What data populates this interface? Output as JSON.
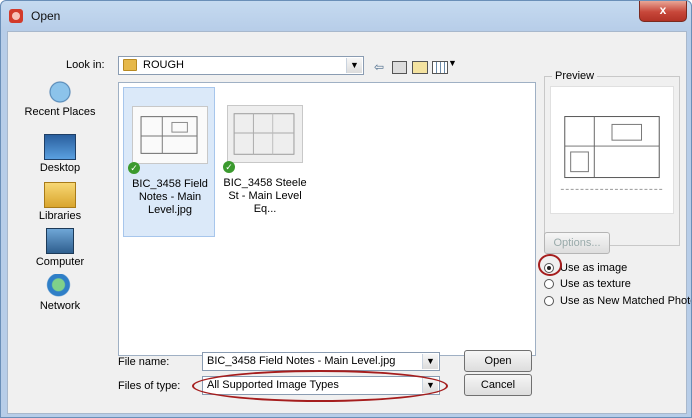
{
  "window": {
    "title": "Open",
    "close_label": "x"
  },
  "look_in": {
    "label": "Look in:",
    "value": "ROUGH"
  },
  "places": [
    {
      "label": "Recent Places",
      "icon": "recent-places-icon"
    },
    {
      "label": "Desktop",
      "icon": "desktop-icon"
    },
    {
      "label": "Libraries",
      "icon": "libraries-icon"
    },
    {
      "label": "Computer",
      "icon": "computer-icon"
    },
    {
      "label": "Network",
      "icon": "network-icon"
    }
  ],
  "files": [
    {
      "name": "BIC_3458 Field Notes - Main Level.jpg",
      "selected": true
    },
    {
      "name": "BIC_3458 Steele St - Main Level Eq...",
      "selected": false
    }
  ],
  "preview": {
    "label": "Preview"
  },
  "options_button": "Options...",
  "radios": [
    {
      "label": "Use as image",
      "checked": true
    },
    {
      "label": "Use as texture",
      "checked": false
    },
    {
      "label": "Use as New Matched Photo",
      "checked": false
    }
  ],
  "file_name": {
    "label": "File name:",
    "value": "BIC_3458 Field Notes - Main Level.jpg"
  },
  "files_of_type": {
    "label": "Files of type:",
    "value": "All Supported Image Types"
  },
  "buttons": {
    "open": "Open",
    "cancel": "Cancel"
  },
  "colors": {
    "highlight_ellipse": "#a51d1d",
    "selection": "#dbe9f9"
  }
}
